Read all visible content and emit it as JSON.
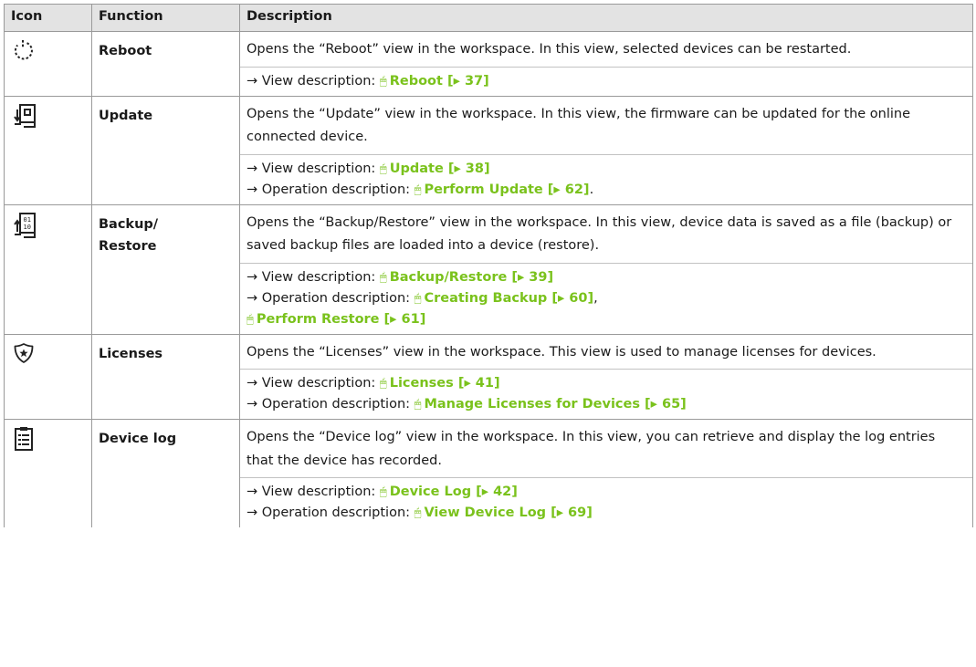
{
  "header": {
    "icon": "Icon",
    "function": "Function",
    "description": "Description"
  },
  "link_color": "#7ac21c",
  "rows": [
    {
      "icon": "reboot-icon",
      "function": "Reboot",
      "description": "Opens the “Reboot” view in the workspace. In this view, selected devices can be restarted.",
      "refs": [
        {
          "prefix": "→ View description: ",
          "mouse": "🖱",
          "link": "Reboot [▸ 37]",
          "suffix": ""
        }
      ]
    },
    {
      "icon": "update-icon",
      "function": "Update",
      "description": "Opens the “Update” view in the workspace. In this view, the firmware can be updated for the online connected device.",
      "refs": [
        {
          "prefix": "→ View description: ",
          "mouse": "🖱",
          "link": "Update [▸ 38]",
          "suffix": ""
        },
        {
          "prefix": "→ Operation description: ",
          "mouse": "🖱",
          "link": "Perform Update [▸ 62]",
          "suffix": "."
        }
      ]
    },
    {
      "icon": "backup-restore-icon",
      "function": "Backup/ Restore",
      "description": "Opens the “Backup/Restore” view in the workspace. In this view, device data is saved as a file (backup) or saved backup files are loaded into a device (restore).",
      "refs": [
        {
          "prefix": "→ View description: ",
          "mouse": "🖱",
          "link": "Backup/Restore [▸ 39]",
          "suffix": ""
        },
        {
          "prefix": "→ Operation description: ",
          "mouse": "🖱",
          "link": "Creating Backup [▸ 60]",
          "suffix": ","
        },
        {
          "prefix": "",
          "mouse": "🖱",
          "link": "Perform Restore [▸ 61]",
          "suffix": ""
        }
      ]
    },
    {
      "icon": "licenses-icon",
      "function": "Licenses",
      "description": "Opens the “Licenses” view in the workspace. This view is used to manage licenses for devices.",
      "refs": [
        {
          "prefix": "→ View description: ",
          "mouse": "🖱",
          "link": "Licenses [▸ 41]",
          "suffix": ""
        },
        {
          "prefix": "→ Operation description: ",
          "mouse": "🖱",
          "link": "Manage Licenses for Devices [▸ 65]",
          "suffix": ""
        }
      ]
    },
    {
      "icon": "device-log-icon",
      "function": "Device log",
      "description": "Opens the “Device log” view in the workspace. In this view, you can retrieve and dis­play the log entries that the device has recorded.",
      "refs": [
        {
          "prefix": "→ View description: ",
          "mouse": "🖱",
          "link": "Device Log [▸ 42]",
          "suffix": ""
        },
        {
          "prefix": "→ Operation description: ",
          "mouse": "🖱",
          "link": "View Device Log [▸ 69]",
          "suffix": ""
        }
      ]
    }
  ]
}
